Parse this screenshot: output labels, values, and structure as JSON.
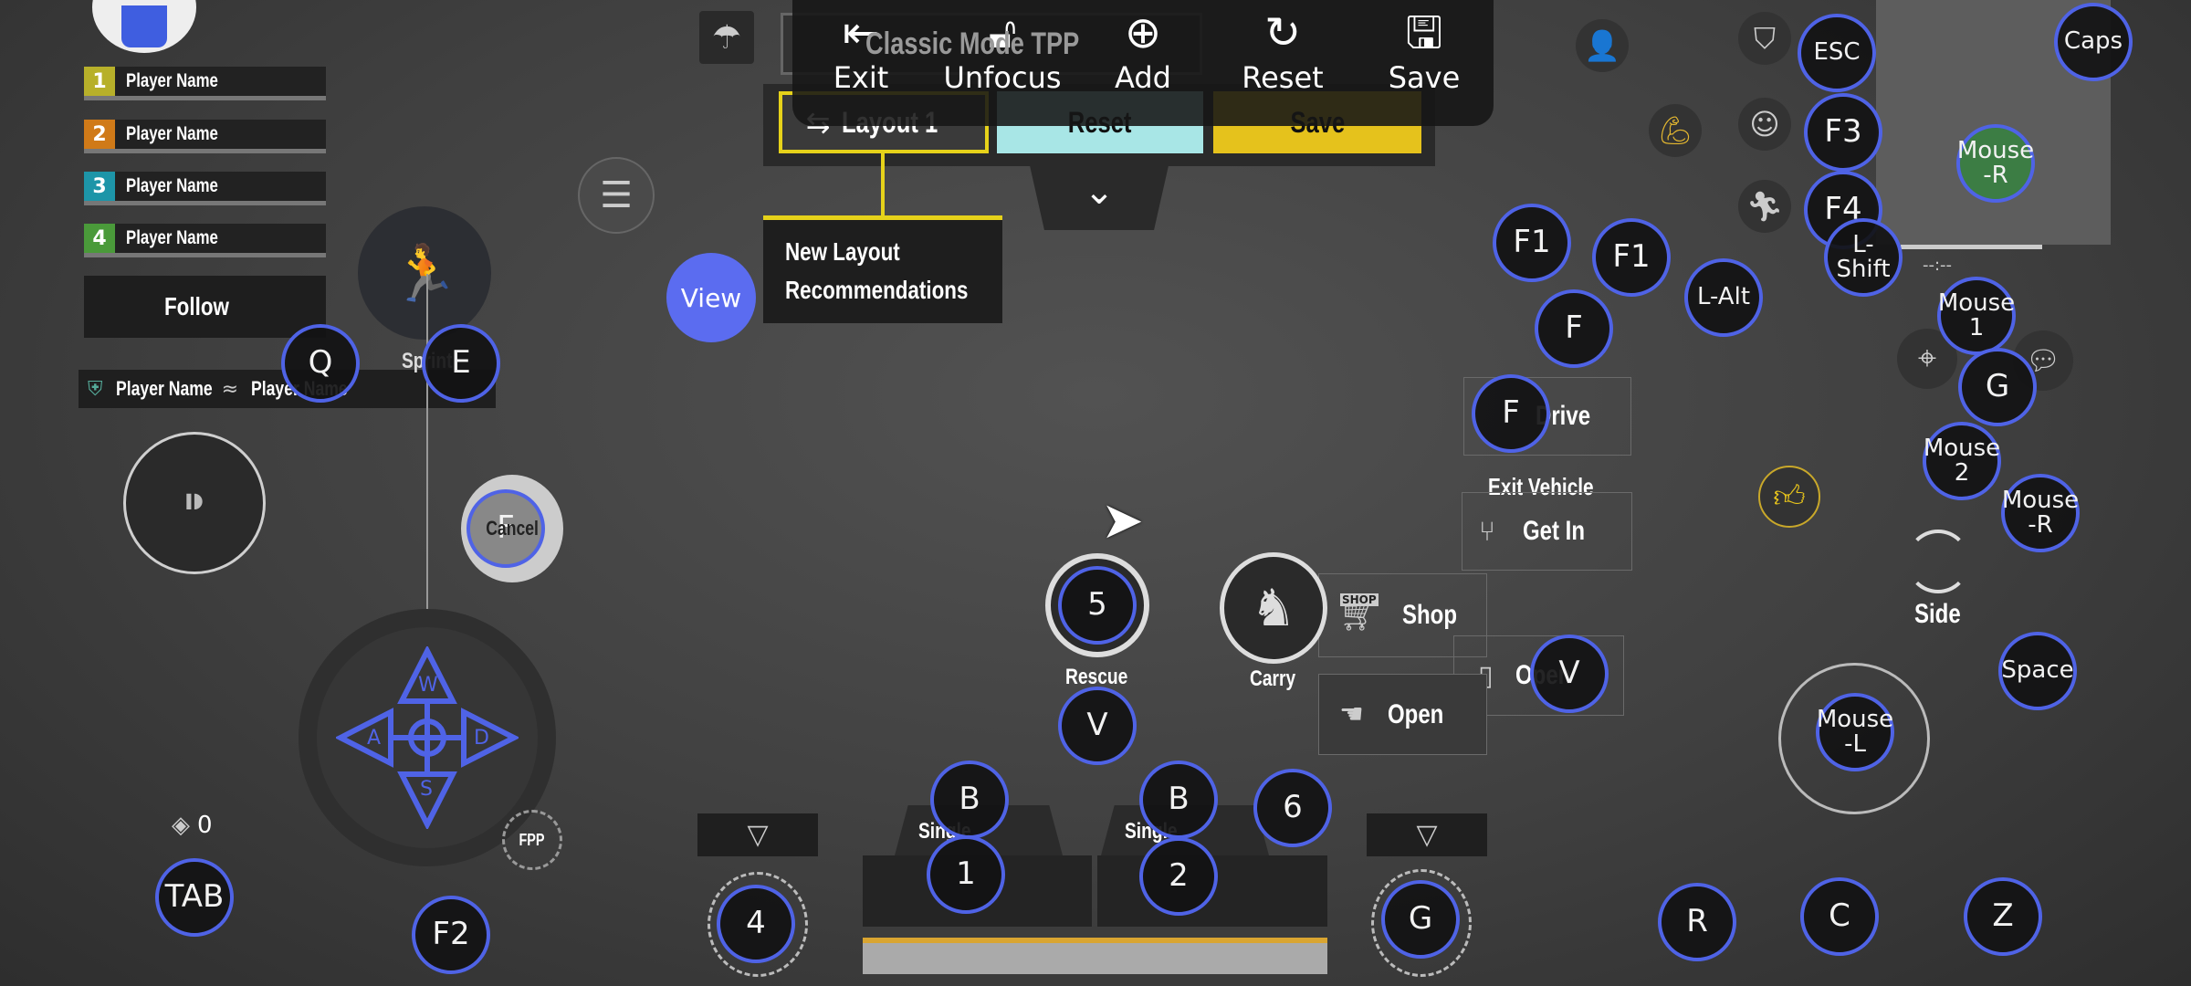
{
  "toolbar": {
    "items": [
      {
        "label": "Exit",
        "icon": "exit-icon"
      },
      {
        "label": "Unfocus",
        "icon": "unlock-icon"
      },
      {
        "label": "Add",
        "icon": "plus-circle-icon"
      },
      {
        "label": "Reset",
        "icon": "reset-icon"
      },
      {
        "label": "Save",
        "icon": "save-icon"
      }
    ]
  },
  "layout_bar": {
    "mode": "Classic Mode TPP",
    "layout": "Layout 1",
    "reset": "Reset",
    "save": "Save"
  },
  "tooltip": {
    "line1": "New Layout",
    "line2": "Recommendations",
    "view": "View"
  },
  "team": {
    "players": [
      {
        "num": "1",
        "name": "Player Name",
        "color": "#b7b02a"
      },
      {
        "num": "2",
        "name": "Player Name",
        "color": "#d07a18"
      },
      {
        "num": "3",
        "name": "Player Name",
        "color": "#1d95a8"
      },
      {
        "num": "4",
        "name": "Player Name",
        "color": "#4a9a3a"
      }
    ],
    "follow": "Follow",
    "kill_left": "Player Name",
    "kill_right": "Player Name"
  },
  "labels": {
    "sprint": "Sprint",
    "cancel": "Cancel",
    "fpp": "FPP",
    "grenade_count": "0",
    "rescue": "Rescue",
    "carry": "Carry",
    "shop": "Shop",
    "open": "Open",
    "open2": "Open",
    "drive": "Drive",
    "exit_vehicle": "Exit Vehicle",
    "get_in": "Get In",
    "side": "Side",
    "single1": "Single",
    "single2": "Single",
    "timer": "--:--",
    "shop_tag": "SHOP"
  },
  "keys": [
    "Q",
    "E",
    "F",
    "TAB",
    "F2",
    "4",
    "B",
    "1",
    "B",
    "2",
    "6",
    "5",
    "V",
    "G",
    "V",
    "F",
    "F",
    "F1",
    "F1",
    "L-Alt",
    "ESC",
    "F3",
    "F4",
    "L-Shift",
    "Caps",
    "Mouse\n-R",
    "Mouse\n1",
    "G",
    "Mouse\n2",
    "Mouse\n-R",
    "Space",
    "Mouse\n-L",
    "R",
    "C",
    "Z",
    "W",
    "A",
    "S",
    "D"
  ],
  "colors": {
    "key_border": "#4f63e6",
    "view_button": "#5b6cf0",
    "reset_button": "#a8e6e6",
    "save_button": "#e5c21c",
    "minimap_marker": "#3c7d44",
    "highlight": "#e6d21a"
  }
}
